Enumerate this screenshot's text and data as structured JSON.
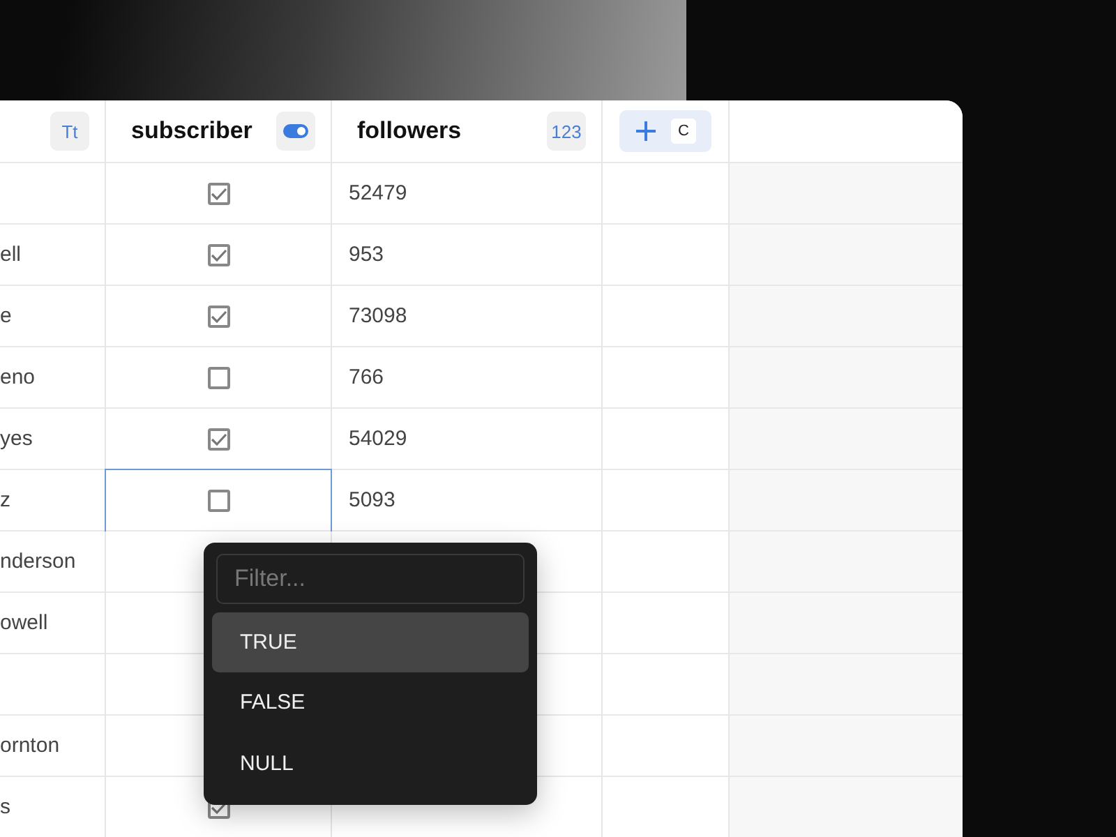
{
  "columns": [
    {
      "kind": "text",
      "icon": "Tt"
    },
    {
      "kind": "boolean",
      "label": "subscriber"
    },
    {
      "kind": "number",
      "label": "followers",
      "icon": "123"
    }
  ],
  "add_column": {
    "shortcut": "C"
  },
  "rows": [
    {
      "subscriber": true,
      "followers": "52479",
      "focused": false
    },
    {
      "name": "ell",
      "subscriber": true,
      "followers": "953",
      "focused": false
    },
    {
      "name": "e",
      "subscriber": true,
      "followers": "73098",
      "focused": false
    },
    {
      "name": "eno",
      "subscriber": false,
      "followers": "766",
      "focused": false
    },
    {
      "name": "yes",
      "subscriber": true,
      "followers": "54029",
      "focused": false
    },
    {
      "name": "z",
      "subscriber": false,
      "followers": "5093",
      "focused": true
    },
    {
      "name": "nderson",
      "focused": false
    },
    {
      "name": "owell",
      "focused": false
    },
    {
      "focused": false
    },
    {
      "name": "ornton",
      "focused": false
    },
    {
      "name": "s",
      "subscriber": true,
      "focused": false
    }
  ],
  "dropdown": {
    "placeholder": "Filter...",
    "options": [
      {
        "label": "TRUE",
        "selected": true
      },
      {
        "label": "FALSE",
        "selected": false
      },
      {
        "label": "NULL",
        "selected": false
      }
    ]
  }
}
